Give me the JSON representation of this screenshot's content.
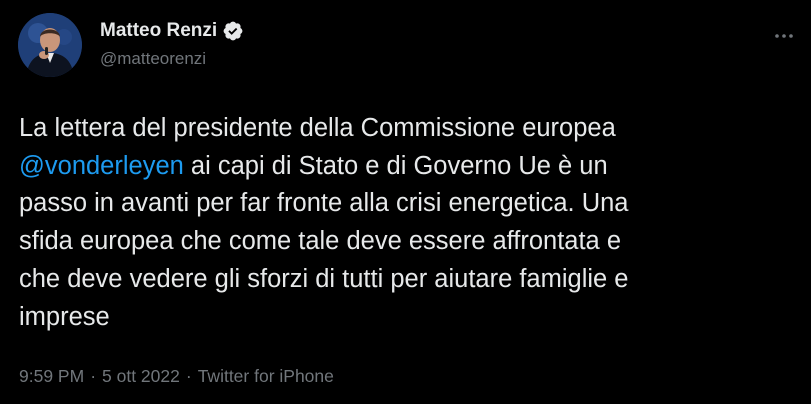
{
  "author": {
    "display_name": "Matteo Renzi",
    "handle": "@matteorenzi",
    "verified": true
  },
  "tweet": {
    "lines": [
      {
        "text": "La lettera del presidente della Commissione europea"
      },
      {
        "mention": "@vonderleyen",
        "text": " ai capi di Stato e di Governo Ue è un"
      },
      {
        "text": "passo in avanti per far fronte alla crisi energetica. Una"
      },
      {
        "text": "sfida europea che come tale deve essere affrontata e"
      },
      {
        "text": "che deve vedere gli sforzi di tutti per aiutare famiglie e"
      },
      {
        "text": "imprese"
      }
    ]
  },
  "meta": {
    "time": "9:59 PM",
    "date": "5 ott 2022",
    "source": "Twitter for iPhone",
    "separator": "·"
  },
  "icons": {
    "verified": "verified-badge-icon",
    "more": "more-options-icon"
  },
  "colors": {
    "background": "#000000",
    "text": "#e7e9ea",
    "secondary": "#71767b",
    "accent": "#1d9bf0"
  }
}
